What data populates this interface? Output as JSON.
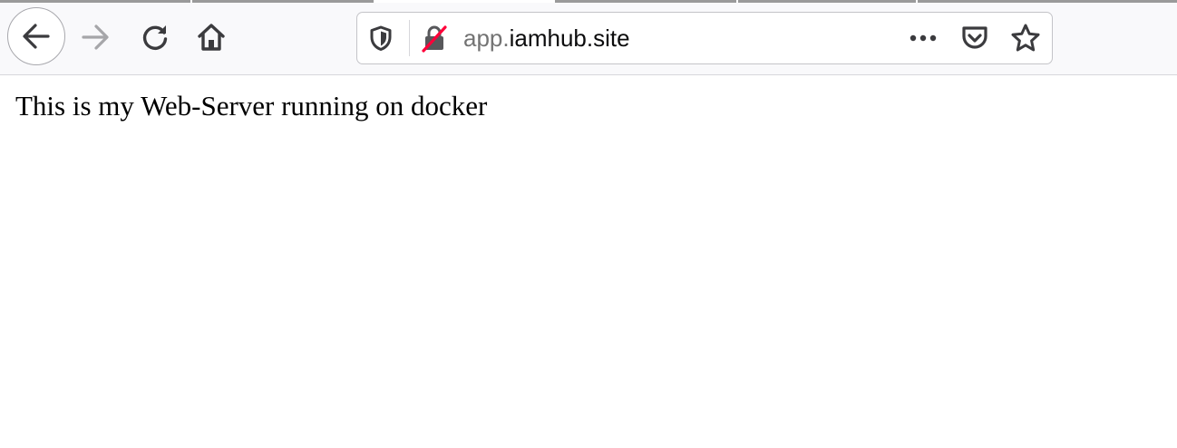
{
  "toolbar": {
    "back_icon": "arrow-left-icon",
    "forward_icon": "arrow-right-icon",
    "reload_icon": "reload-icon",
    "home_icon": "home-icon"
  },
  "urlbar": {
    "url_prefix": "app.",
    "url_host": "iamhub.site",
    "tracking_icon": "shield-icon",
    "security_icon": "insecure-lock-icon",
    "more_icon": "ellipsis-icon",
    "pocket_icon": "pocket-icon",
    "bookmark_icon": "star-icon",
    "insecure_color": "#ff0039"
  },
  "page": {
    "body_text": "This is my Web-Server running on docker"
  }
}
